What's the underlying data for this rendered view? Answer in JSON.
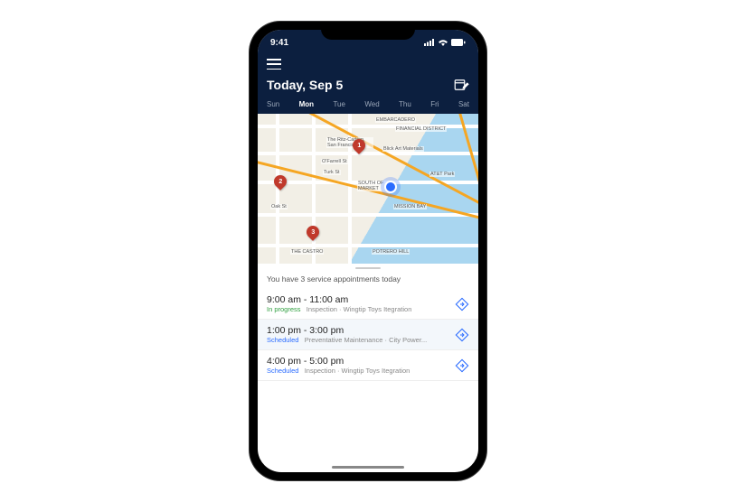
{
  "status": {
    "time": "9:41"
  },
  "header": {
    "title": "Today, Sep 5"
  },
  "days": [
    {
      "label": "Sun",
      "active": false
    },
    {
      "label": "Mon",
      "active": true
    },
    {
      "label": "Tue",
      "active": false
    },
    {
      "label": "Wed",
      "active": false
    },
    {
      "label": "Thu",
      "active": false
    },
    {
      "label": "Fri",
      "active": false
    },
    {
      "label": "Sat",
      "active": false
    }
  ],
  "map": {
    "pins": [
      {
        "num": "1"
      },
      {
        "num": "2"
      },
      {
        "num": "3"
      }
    ],
    "labels": {
      "embarcadero": "EMBARCADERO",
      "financial": "FINANCIAL DISTRICT",
      "ritz": "The Ritz-Carlton, San Francisco",
      "blick": "Blick Art Materials",
      "ofarrell": "O'Farrell St",
      "turk": "Turk St",
      "oak": "Oak St",
      "att": "AT&T Park",
      "soma": "SOUTH OF MARKET",
      "mission": "MISSION BAY",
      "castro": "THE CASTRO",
      "potrero": "POTRERO HILL"
    }
  },
  "sheet": {
    "summary": "You have 3 service appointments today",
    "appointments": [
      {
        "time": "9:00 am - 11:00 am",
        "statusLabel": "In progress",
        "statusClass": "inprogress",
        "detail": "Inspection · Wingtip Toys Itegration"
      },
      {
        "time": "1:00 pm - 3:00 pm",
        "statusLabel": "Scheduled",
        "statusClass": "scheduled",
        "detail": "Preventative Maintenance · City Power..."
      },
      {
        "time": "4:00 pm - 5:00 pm",
        "statusLabel": "Scheduled",
        "statusClass": "scheduled",
        "detail": "Inspection · Wingtip Toys Itegration"
      }
    ]
  }
}
